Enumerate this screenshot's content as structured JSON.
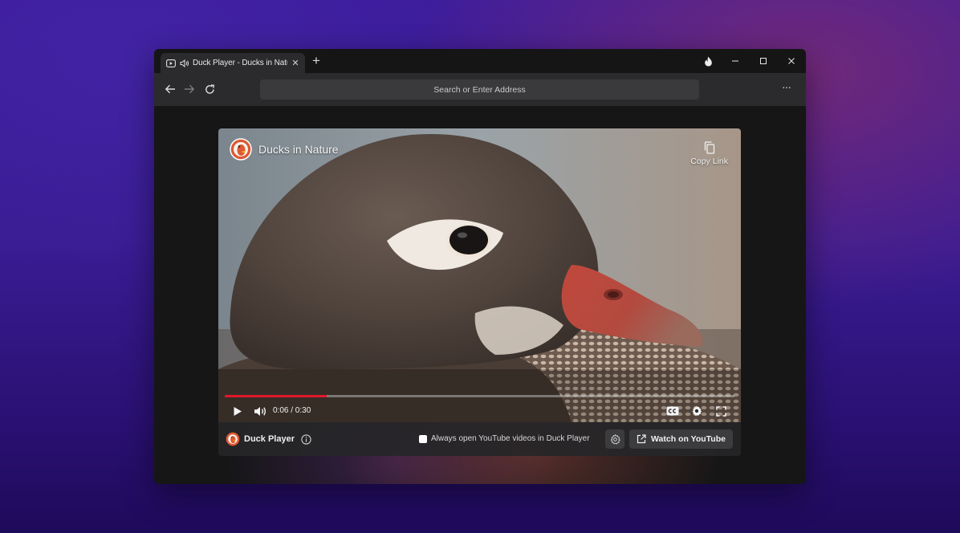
{
  "tab": {
    "title": "Duck Player - Ducks in Nature",
    "icons": [
      "video-icon",
      "speaker-icon"
    ],
    "close_glyph": "✕"
  },
  "new_tab_glyph": "+",
  "window_controls": [
    "fire-icon",
    "minimize-icon",
    "maximize-icon",
    "close-icon"
  ],
  "toolbar": {
    "address_placeholder": "Search or Enter Address",
    "more_glyph": "···"
  },
  "video": {
    "title": "Ducks in Nature",
    "copy_link_label": "Copy Link",
    "time": "0:06 / 0:30",
    "progress_fraction": 0.2
  },
  "footer": {
    "brand": "Duck Player",
    "always_open_label": "Always open YouTube videos in Duck Player",
    "always_open_checked": false,
    "watch_label": "Watch on YouTube"
  },
  "colors": {
    "progress": "#e0182a",
    "duck_brand": "#de5833"
  }
}
